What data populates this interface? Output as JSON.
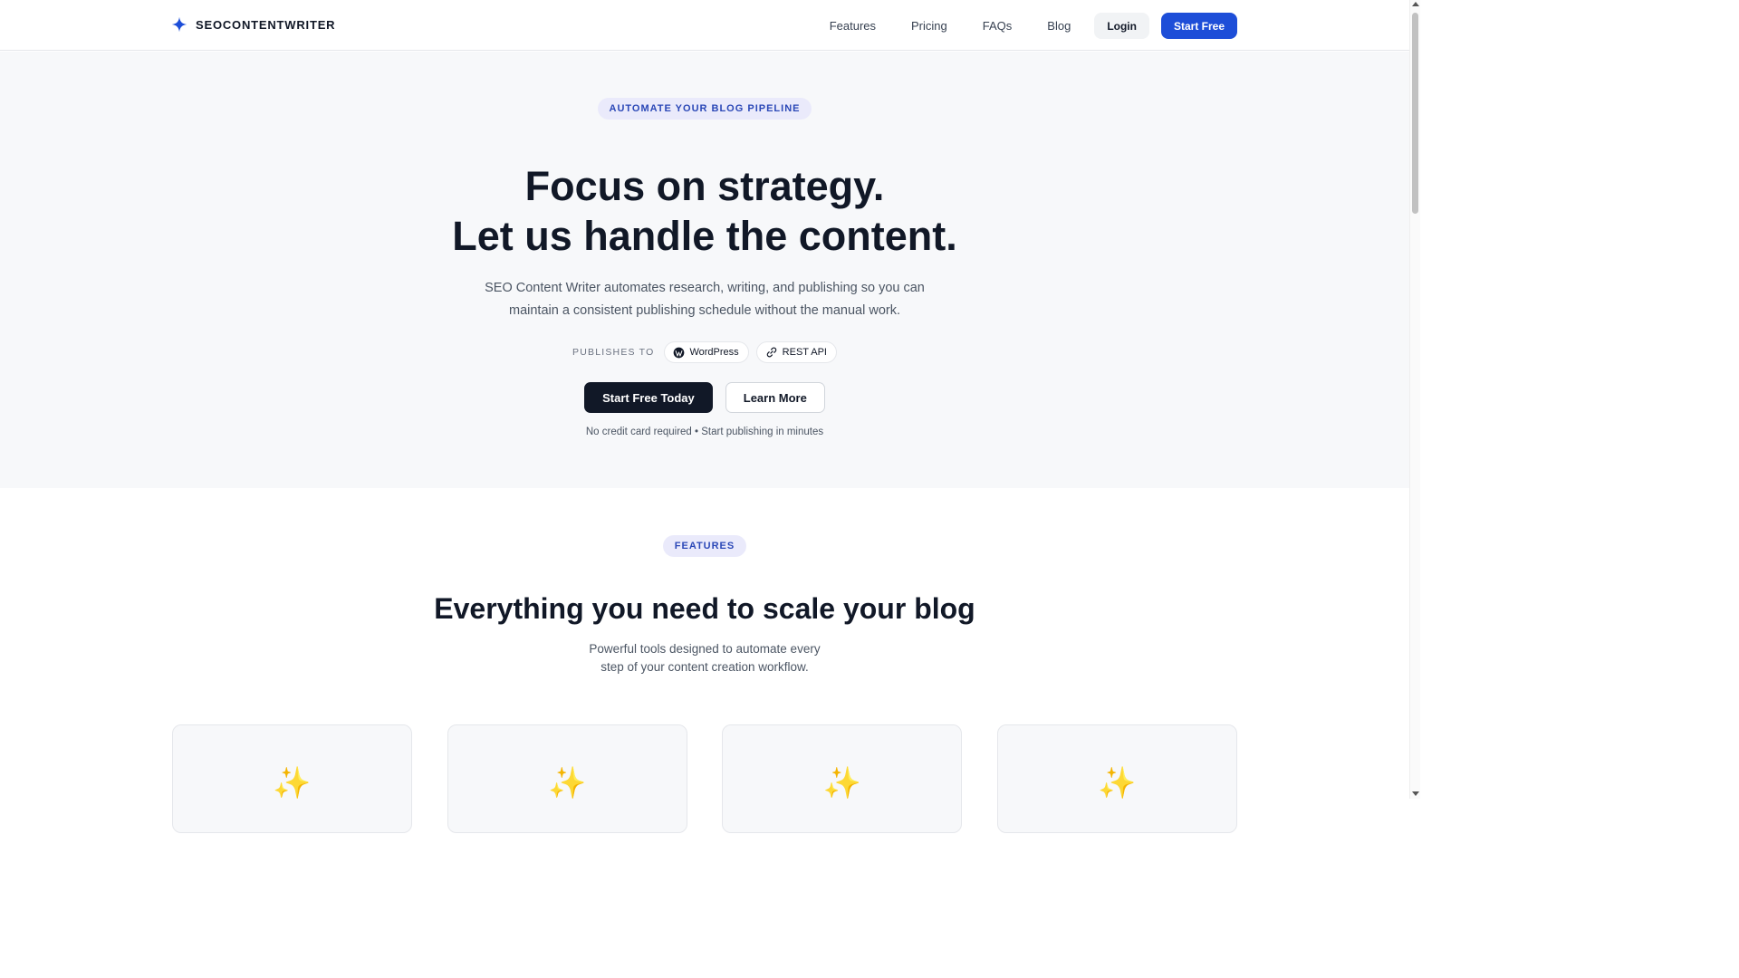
{
  "header": {
    "brand": "SEOCONTENTWRITER",
    "nav": [
      {
        "label": "Features"
      },
      {
        "label": "Pricing"
      },
      {
        "label": "FAQs"
      },
      {
        "label": "Blog"
      }
    ],
    "login_label": "Login",
    "start_free_label": "Start Free"
  },
  "hero": {
    "badge": "AUTOMATE YOUR BLOG PIPELINE",
    "title_line1": "Focus on strategy.",
    "title_line2": "Let us handle the content.",
    "description": "SEO Content Writer automates research, writing, and publishing so you can maintain a consistent publishing schedule without the manual work.",
    "publishes_label": "PUBLISHES TO",
    "integrations": [
      {
        "label": "WordPress",
        "icon": "wordpress-icon"
      },
      {
        "label": "REST API",
        "icon": "link-icon"
      }
    ],
    "primary_cta": "Start Free Today",
    "secondary_cta": "Learn More",
    "note": "No credit card required • Start publishing in minutes"
  },
  "features": {
    "badge": "FEATURES",
    "title": "Everything you need to scale your blog",
    "description": "Powerful tools designed to automate every step of your content creation workflow.",
    "cards": [
      {
        "icon": "✨"
      },
      {
        "icon": "✨"
      },
      {
        "icon": "✨"
      },
      {
        "icon": "✨"
      }
    ]
  },
  "colors": {
    "accent": "#1d4ed8",
    "badge_bg": "#eaeafb",
    "badge_text": "#2b48b7",
    "dark": "#111827",
    "hero_bg": "#f7f8fa"
  }
}
